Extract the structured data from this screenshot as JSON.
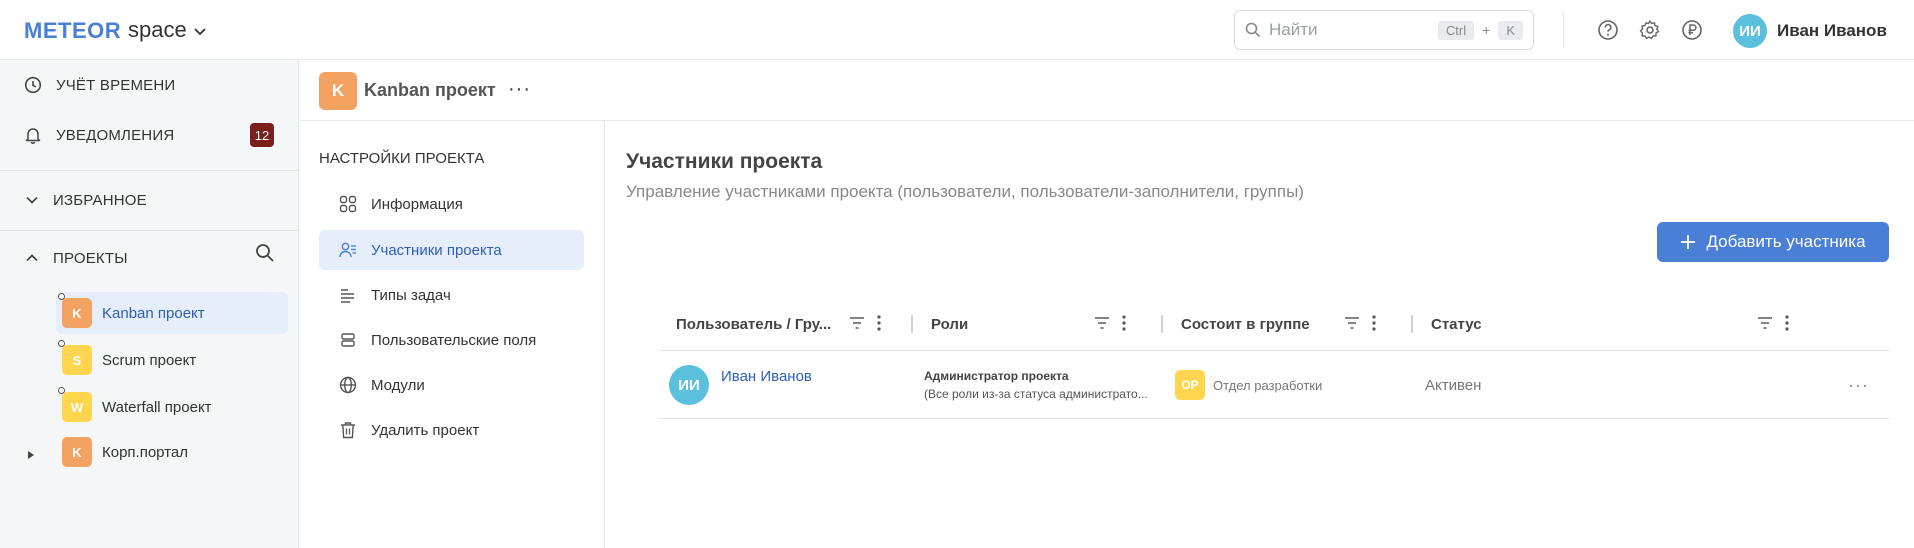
{
  "topbar": {
    "logo": "METEOR",
    "workspace": "space",
    "search": {
      "placeholder": "Найти",
      "kbd_ctrl": "Ctrl",
      "kbd_plus": "+",
      "kbd_key": "K"
    },
    "icons": [
      "help-icon",
      "settings-icon",
      "ruble-icon"
    ],
    "user": {
      "initials": "ИИ",
      "name": "Иван Иванов"
    }
  },
  "sidebar": {
    "time_tracking": "УЧЁТ ВРЕМЕНИ",
    "notifications": "УВЕДОМЛЕНИЯ",
    "notifications_count": "12",
    "favorites": "ИЗБРАННОЕ",
    "projects": "ПРОЕКТЫ",
    "project_list": [
      {
        "letter": "K",
        "name": "Kanban проект",
        "color": "#f4a261",
        "active": true
      },
      {
        "letter": "S",
        "name": "Scrum проект",
        "color": "#ffd54f",
        "active": false
      },
      {
        "letter": "W",
        "name": "Waterfall проект",
        "color": "#ffd54f",
        "active": false
      },
      {
        "letter": "K",
        "name": "Корп.портал",
        "color": "#f4a261",
        "active": false
      }
    ]
  },
  "project_header": {
    "letter": "K",
    "title": "Kanban проект",
    "more": "···"
  },
  "settings": {
    "title": "НАСТРОЙКИ ПРОЕКТА",
    "items": [
      {
        "label": "Информация",
        "icon": "grid-icon"
      },
      {
        "label": "Участники проекта",
        "icon": "members-icon"
      },
      {
        "label": "Типы задач",
        "icon": "list-icon"
      },
      {
        "label": "Пользовательские поля",
        "icon": "fields-icon"
      },
      {
        "label": "Модули",
        "icon": "globe-icon"
      },
      {
        "label": "Удалить проект",
        "icon": "trash-icon"
      }
    ]
  },
  "content": {
    "title": "Участники проекта",
    "subtitle": "Управление участниками проекта (пользователи, пользователи-заполнители, группы)",
    "add_button": "Добавить участника",
    "table": {
      "columns": [
        "Пользователь / Гру...",
        "Роли",
        "Состоит в группе",
        "Статус"
      ],
      "rows": [
        {
          "initials": "ИИ",
          "user": "Иван Иванов",
          "role_title": "Администратор проекта",
          "role_note": "(Все роли из-за статуса администрато...",
          "group_initials": "ОР",
          "group": "Отдел разработки",
          "status": "Активен",
          "more": "···"
        }
      ]
    }
  },
  "colors": {
    "accent": "#4a7fd6",
    "active_bg": "#e6eefb",
    "badge": "#7a1e1e"
  }
}
